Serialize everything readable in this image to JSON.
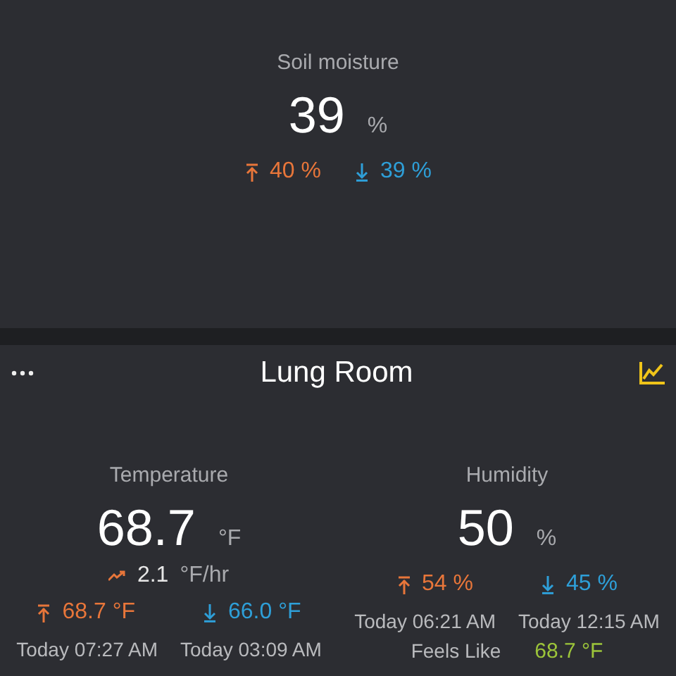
{
  "soil": {
    "label": "Soil moisture",
    "value": "39",
    "unit": "%",
    "high": "40 %",
    "low": "39 %"
  },
  "room": {
    "title": "Lung Room",
    "sensors": [
      {
        "kind": "temperature",
        "label": "Temperature",
        "value": "68.7",
        "unit": "°F",
        "trend": "2.1",
        "trend_unit": "°F/hr",
        "high": "68.7 °F",
        "low": "66.0 °F",
        "high_time": "Today 07:27 AM",
        "low_time": "Today 03:09 AM"
      },
      {
        "kind": "humidity",
        "label": "Humidity",
        "value": "50",
        "unit": "%",
        "high": "54 %",
        "low": "45 %",
        "high_time": "Today 06:21 AM",
        "low_time": "Today 12:15 AM",
        "feels_like_label": "Feels Like",
        "feels_like_value": "68.7 °F"
      }
    ]
  }
}
